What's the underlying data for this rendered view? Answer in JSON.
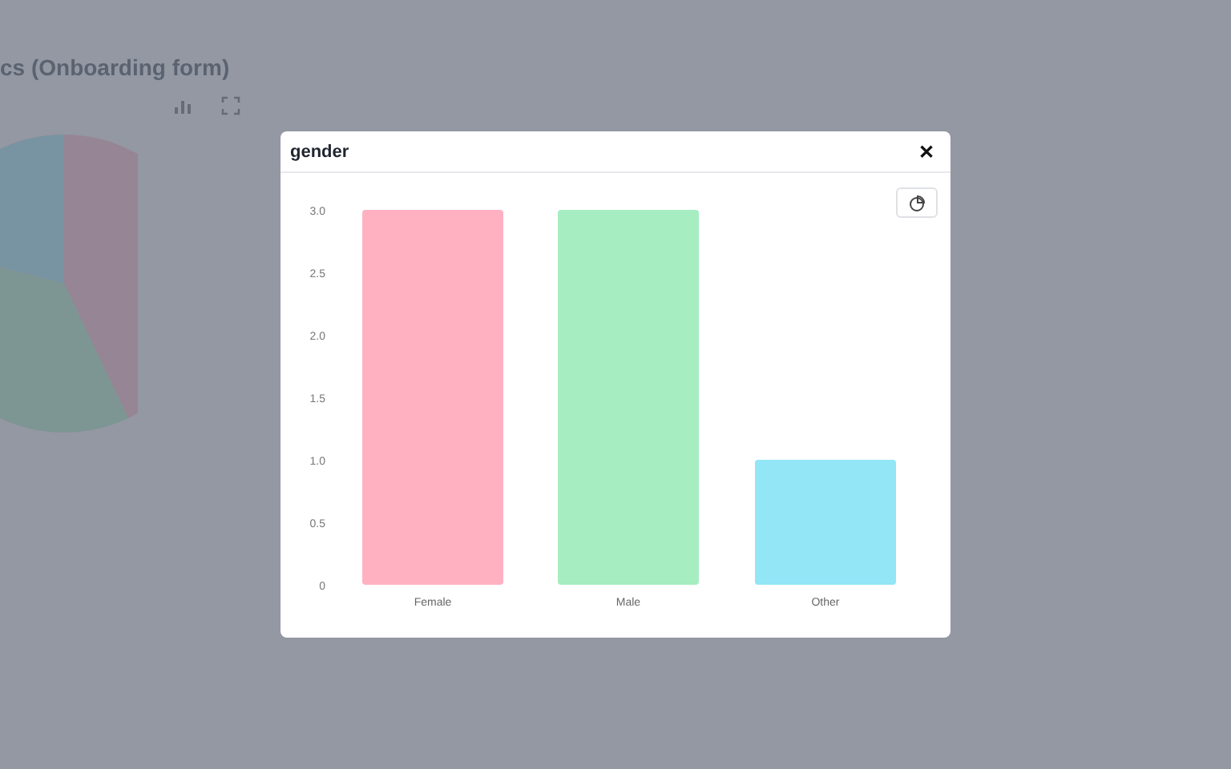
{
  "page": {
    "title": "cs (Onboarding form)"
  },
  "dialog": {
    "title": "gender",
    "close": "✕",
    "chart_data": {
      "type": "bar",
      "categories": [
        "Female",
        "Male",
        "Other"
      ],
      "series": [
        {
          "colors": [
            "#ffb1c1",
            "#a6edc2",
            "#92e6f5"
          ],
          "values": [
            3,
            3,
            1
          ]
        }
      ],
      "ylim": [
        0,
        3
      ],
      "yticks": [
        {
          "value": 0,
          "label": "0"
        },
        {
          "value": 0.5,
          "label": "0.5"
        },
        {
          "value": 1,
          "label": "1.0"
        },
        {
          "value": 1.5,
          "label": "1.5"
        },
        {
          "value": 2,
          "label": "2.0"
        },
        {
          "value": 2.5,
          "label": "2.5"
        },
        {
          "value": 3,
          "label": "3.0"
        }
      ]
    }
  }
}
